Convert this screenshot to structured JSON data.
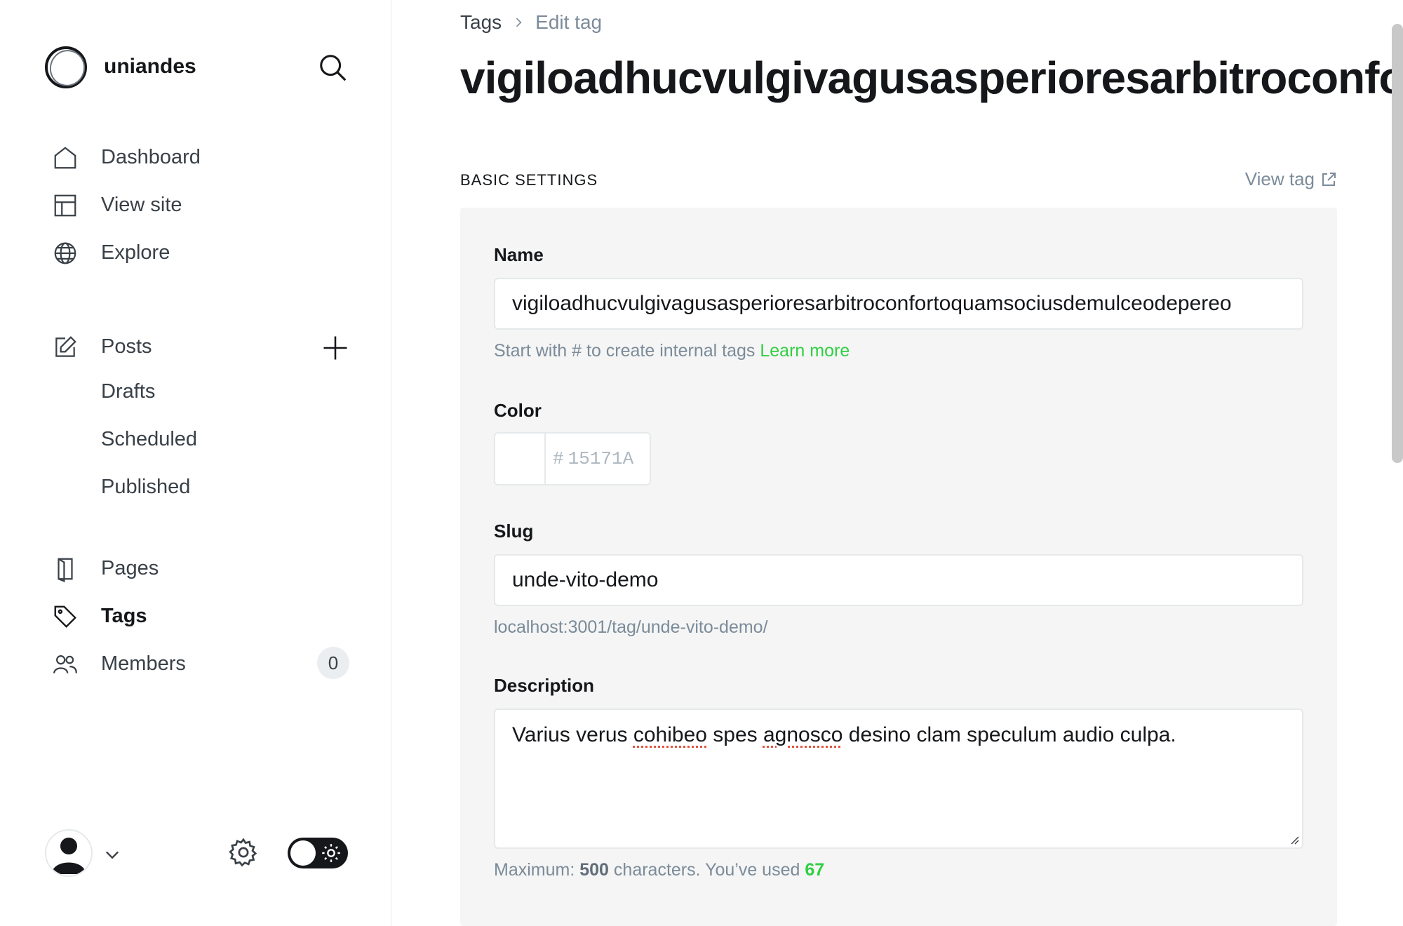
{
  "brand": {
    "name": "uniandes"
  },
  "nav": {
    "dashboard": "Dashboard",
    "view_site": "View site",
    "explore": "Explore",
    "posts": "Posts",
    "drafts": "Drafts",
    "scheduled": "Scheduled",
    "published": "Published",
    "pages": "Pages",
    "tags": "Tags",
    "members": "Members",
    "members_count": "0"
  },
  "breadcrumb": {
    "parent": "Tags",
    "current": "Edit tag"
  },
  "page": {
    "title": "vigiloadhucvulgivagusasperioresarbitroconfortoquamsociusdemulceodepereo"
  },
  "section": {
    "heading": "BASIC SETTINGS",
    "view_tag": "View tag"
  },
  "form": {
    "name": {
      "label": "Name",
      "value": "vigiloadhucvulgivagusasperioresarbitroconfortoquamsociusdemulceodepereo",
      "hint": "Start with # to create internal tags",
      "hint_link": "Learn more"
    },
    "color": {
      "label": "Color",
      "hash": "#",
      "placeholder": "15171A",
      "swatch": "#ffffff"
    },
    "slug": {
      "label": "Slug",
      "value": "unde-vito-demo",
      "url": "localhost:3001/tag/unde-vito-demo/"
    },
    "description": {
      "label": "Description",
      "text_before": "Varius verus ",
      "misspelled_1": "cohibeo",
      "text_middle": " spes ",
      "misspelled_2": "agnosco",
      "text_after": " desino clam speculum audio culpa.",
      "max_prefix": "Maximum:",
      "max_value": "500",
      "max_mid": "characters. You’ve used",
      "used": "67"
    }
  },
  "colors": {
    "accent_green": "#30cf43",
    "text_dark": "#15171a",
    "muted": "#7c8b9a",
    "panel_bg": "#f4f5f4"
  }
}
